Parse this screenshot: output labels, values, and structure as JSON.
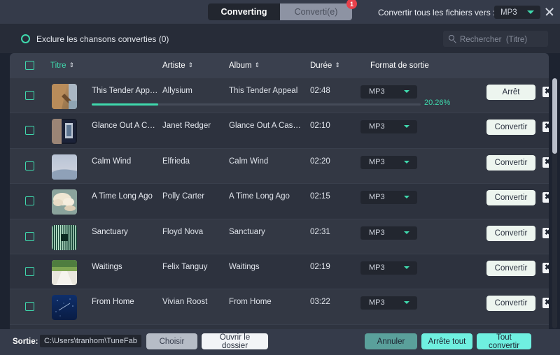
{
  "window": {
    "close_icon": "close-icon"
  },
  "header": {
    "tabs": [
      {
        "label": "Converting",
        "active": true,
        "badge": null
      },
      {
        "label": "Converti(e)",
        "active": false,
        "badge": "1"
      }
    ],
    "convert_all_label": "Convertir tous les fichiers vers :",
    "format_value": "MP3"
  },
  "exclude": {
    "label": "Exclure les chansons converties (0)"
  },
  "search": {
    "placeholder": "Rechercher  (Titre)",
    "value": ""
  },
  "table": {
    "columns": [
      {
        "key": "title",
        "label": "Titre",
        "sortable": true
      },
      {
        "key": "artist",
        "label": "Artiste",
        "sortable": true
      },
      {
        "key": "album",
        "label": "Album",
        "sortable": true
      },
      {
        "key": "duration",
        "label": "Durée",
        "sortable": true
      },
      {
        "key": "format",
        "label": "Format de sortie",
        "sortable": false
      }
    ],
    "rows": [
      {
        "title": "This Tender Appeal",
        "artist": "Allysium",
        "album": "This Tender Appeal",
        "duration": "02:48",
        "format": "MP3",
        "action": "Arrêt",
        "converting": true,
        "progress_percent": 20.26,
        "progress_label": "20.26%",
        "art": "desert-rock"
      },
      {
        "title": "Glance Out A Case…",
        "artist": "Janet Redger",
        "album": "Glance Out A Caseme…",
        "duration": "02:10",
        "format": "MP3",
        "action": "Convertir",
        "converting": false,
        "art": "dark-door"
      },
      {
        "title": "Calm Wind",
        "artist": "Elfrieda",
        "album": "Calm Wind",
        "duration": "02:20",
        "format": "MP3",
        "action": "Convertir",
        "converting": false,
        "art": "pale-sky"
      },
      {
        "title": "A Time Long Ago",
        "artist": "Polly Carter",
        "album": "A Time Long Ago",
        "duration": "02:15",
        "format": "MP3",
        "action": "Convertir",
        "converting": false,
        "art": "cloud"
      },
      {
        "title": "Sanctuary",
        "artist": "Floyd Nova",
        "album": "Sanctuary",
        "duration": "02:31",
        "format": "MP3",
        "action": "Convertir",
        "converting": false,
        "art": "green-stripes"
      },
      {
        "title": "Waitings",
        "artist": "Felix Tanguy",
        "album": "Waitings",
        "duration": "02:19",
        "format": "MP3",
        "action": "Convertir",
        "converting": false,
        "art": "green-path"
      },
      {
        "title": "From Home",
        "artist": "Vivian Roost",
        "album": "From Home",
        "duration": "03:22",
        "format": "MP3",
        "action": "Convertir",
        "converting": false,
        "art": "blue-night"
      }
    ]
  },
  "footer": {
    "output_label": "Sortie:",
    "output_path": "C:\\Users\\tranhom\\TuneFab\\…",
    "choose_label": "Choisir",
    "open_folder_label": "Ouvrir le dossier",
    "cancel_label": "Annuler",
    "stop_all_label": "Arrête tout",
    "convert_all_label": "Tout convertir"
  },
  "colors": {
    "accent": "#3fd9ad",
    "accent_button": "#6ff0e0",
    "badge": "#e8414b",
    "panel_bg": "#2f3440",
    "header_bg": "#353b4a"
  }
}
